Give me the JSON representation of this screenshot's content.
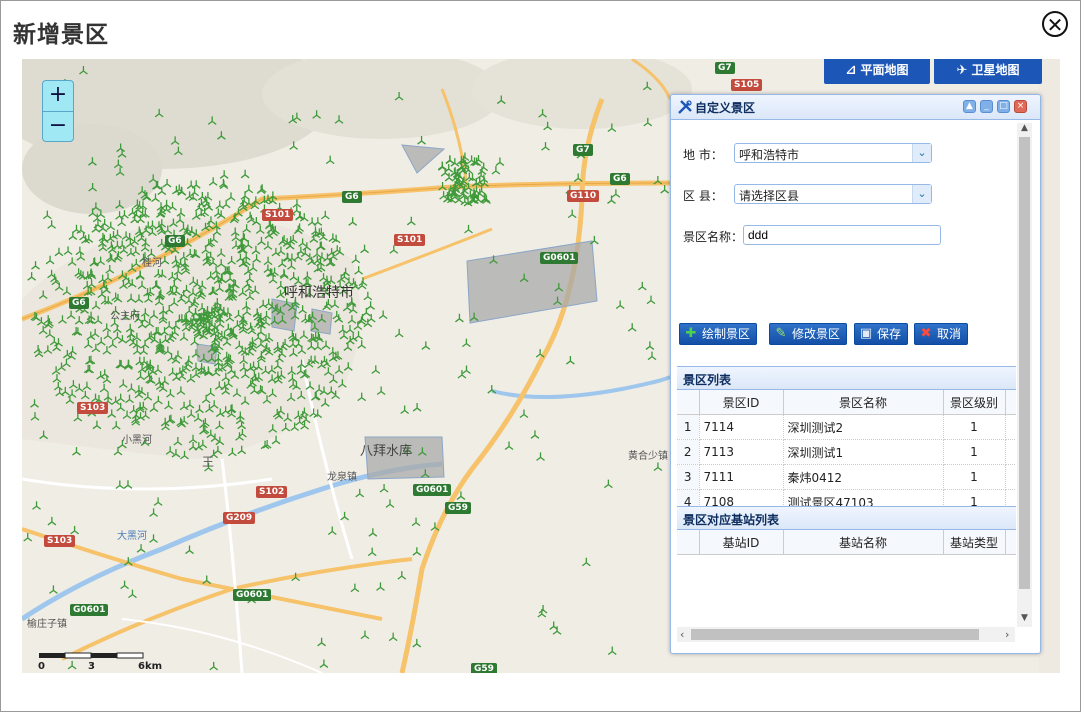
{
  "dialog": {
    "title": "新增景区",
    "close_glyph": "✕"
  },
  "map": {
    "zoom_in": "+",
    "zoom_out": "−",
    "map_types": [
      {
        "label": "平面地图",
        "icon": "map-icon"
      },
      {
        "label": "卫星地图",
        "icon": "satellite-icon"
      }
    ],
    "scale": {
      "t0": "0",
      "t1": "3",
      "t2": "6km"
    },
    "labels": {
      "city": "呼和浩特市",
      "reservoir": "八拜水库",
      "town_wang": "王",
      "town_xiao": "小黑河",
      "town_haoqi": "桂河",
      "town_south": "大黑河",
      "town_bottom": "榆庄子镇",
      "town_right": "黄合少镇",
      "town_village": "龙泉镇",
      "town_gongzhu": "公主府"
    },
    "roads": {
      "g7_top": "G7",
      "s105": "S105",
      "g7_mid": "G7",
      "g6_mid": "G6",
      "g110": "G110",
      "g6_a": "G6",
      "g6_b": "G6",
      "g6_c": "G6",
      "s101": "S101",
      "g0601_a": "G0601",
      "g0601_b": "G0601",
      "g0601_c": "G0601",
      "g0601_d": "G0601",
      "s103_a": "S103",
      "s102": "S102",
      "g209": "G209",
      "g59_a": "G59",
      "g59_b": "G59",
      "s103_b": "S103",
      "s101b": "S101"
    }
  },
  "panel": {
    "title": "自定义景区",
    "fields": {
      "city_label": "地  市：",
      "city_value": "呼和浩特市",
      "county_label": "区  县：",
      "county_value": "请选择区县",
      "name_label": "景区名称：",
      "name_value": "ddd"
    },
    "buttons": {
      "draw": "绘制景区",
      "edit": "修改景区",
      "save": "保存",
      "cancel": "取消"
    },
    "scenic_list": {
      "title": "景区列表",
      "columns": [
        "景区ID",
        "景区名称",
        "景区级别"
      ],
      "rows": [
        {
          "n": "1",
          "id": "7114",
          "name": "深圳测试2",
          "level": "1"
        },
        {
          "n": "2",
          "id": "7113",
          "name": "深圳测试1",
          "level": "1"
        },
        {
          "n": "3",
          "id": "7111",
          "name": "秦炜0412",
          "level": "1"
        },
        {
          "n": "4",
          "id": "7108",
          "name": "测试景区47103",
          "level": "1"
        }
      ]
    },
    "station_list": {
      "title": "景区对应基站列表",
      "columns": [
        "基站ID",
        "基站名称",
        "基站类型"
      ]
    }
  },
  "colors": {
    "accent": "#1c57b7",
    "panel_border": "#95b8e7",
    "station_green": "#3f9a3a",
    "polygon_fill": "#a9a9a9"
  }
}
